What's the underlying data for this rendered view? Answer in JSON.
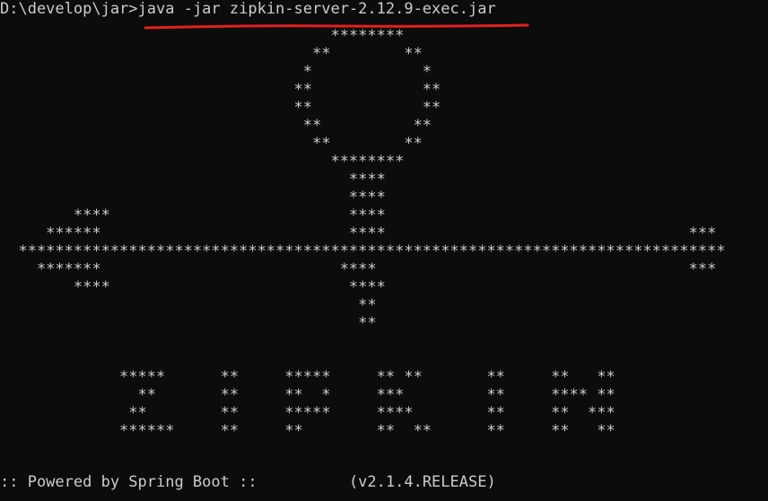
{
  "terminal": {
    "prompt": "D:\\develop\\jar>",
    "command": "java -jar zipkin-server-2.12.9-exec.jar",
    "annotation_color": "#e02020",
    "text_color": "#cccccc",
    "background_color": "#0c0c0c"
  },
  "banner": {
    "art_lines": [
      "                                    ********",
      "                                  **        **",
      "                                 *            *",
      "                                **            **",
      "                                **            **",
      "                                 **          **",
      "                                  **        **",
      "                                    ********",
      "                                      ****",
      "                                      ****",
      "        ****                          ****",
      "     ******                           ****                                 ***",
      "  *****************************************************************************",
      "    *******                          ****                                  ***",
      "        ****                          ****",
      "                                       **",
      "                                       **",
      "",
      "",
      "             *****      **     *****     ** **       **     **   **",
      "               **       **     **  *     ***         **     **** **",
      "              **        **     *****     ****        **     **  ***",
      "             ******     **     **        **  **      **     **   **"
    ],
    "powered_by": ":: Powered by Spring Boot ::",
    "version": "(v2.1.4.RELEASE)"
  }
}
